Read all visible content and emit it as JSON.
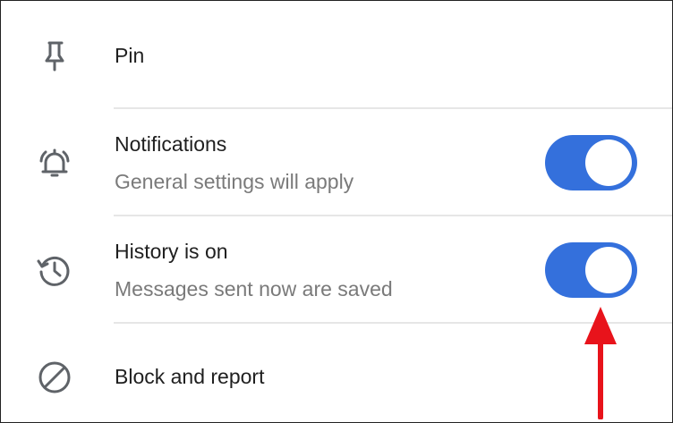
{
  "rows": [
    {
      "title": "Pin",
      "icon": "pin-icon"
    },
    {
      "title": "Notifications",
      "subtitle": "General settings will apply",
      "icon": "bell-icon",
      "toggle_on": true
    },
    {
      "title": "History is on",
      "subtitle": "Messages sent now are saved",
      "icon": "history-icon",
      "toggle_on": true
    },
    {
      "title": "Block and report",
      "icon": "block-icon"
    }
  ],
  "colors": {
    "toggle_on": "#3470dc",
    "annotation_arrow": "#e8131b"
  }
}
